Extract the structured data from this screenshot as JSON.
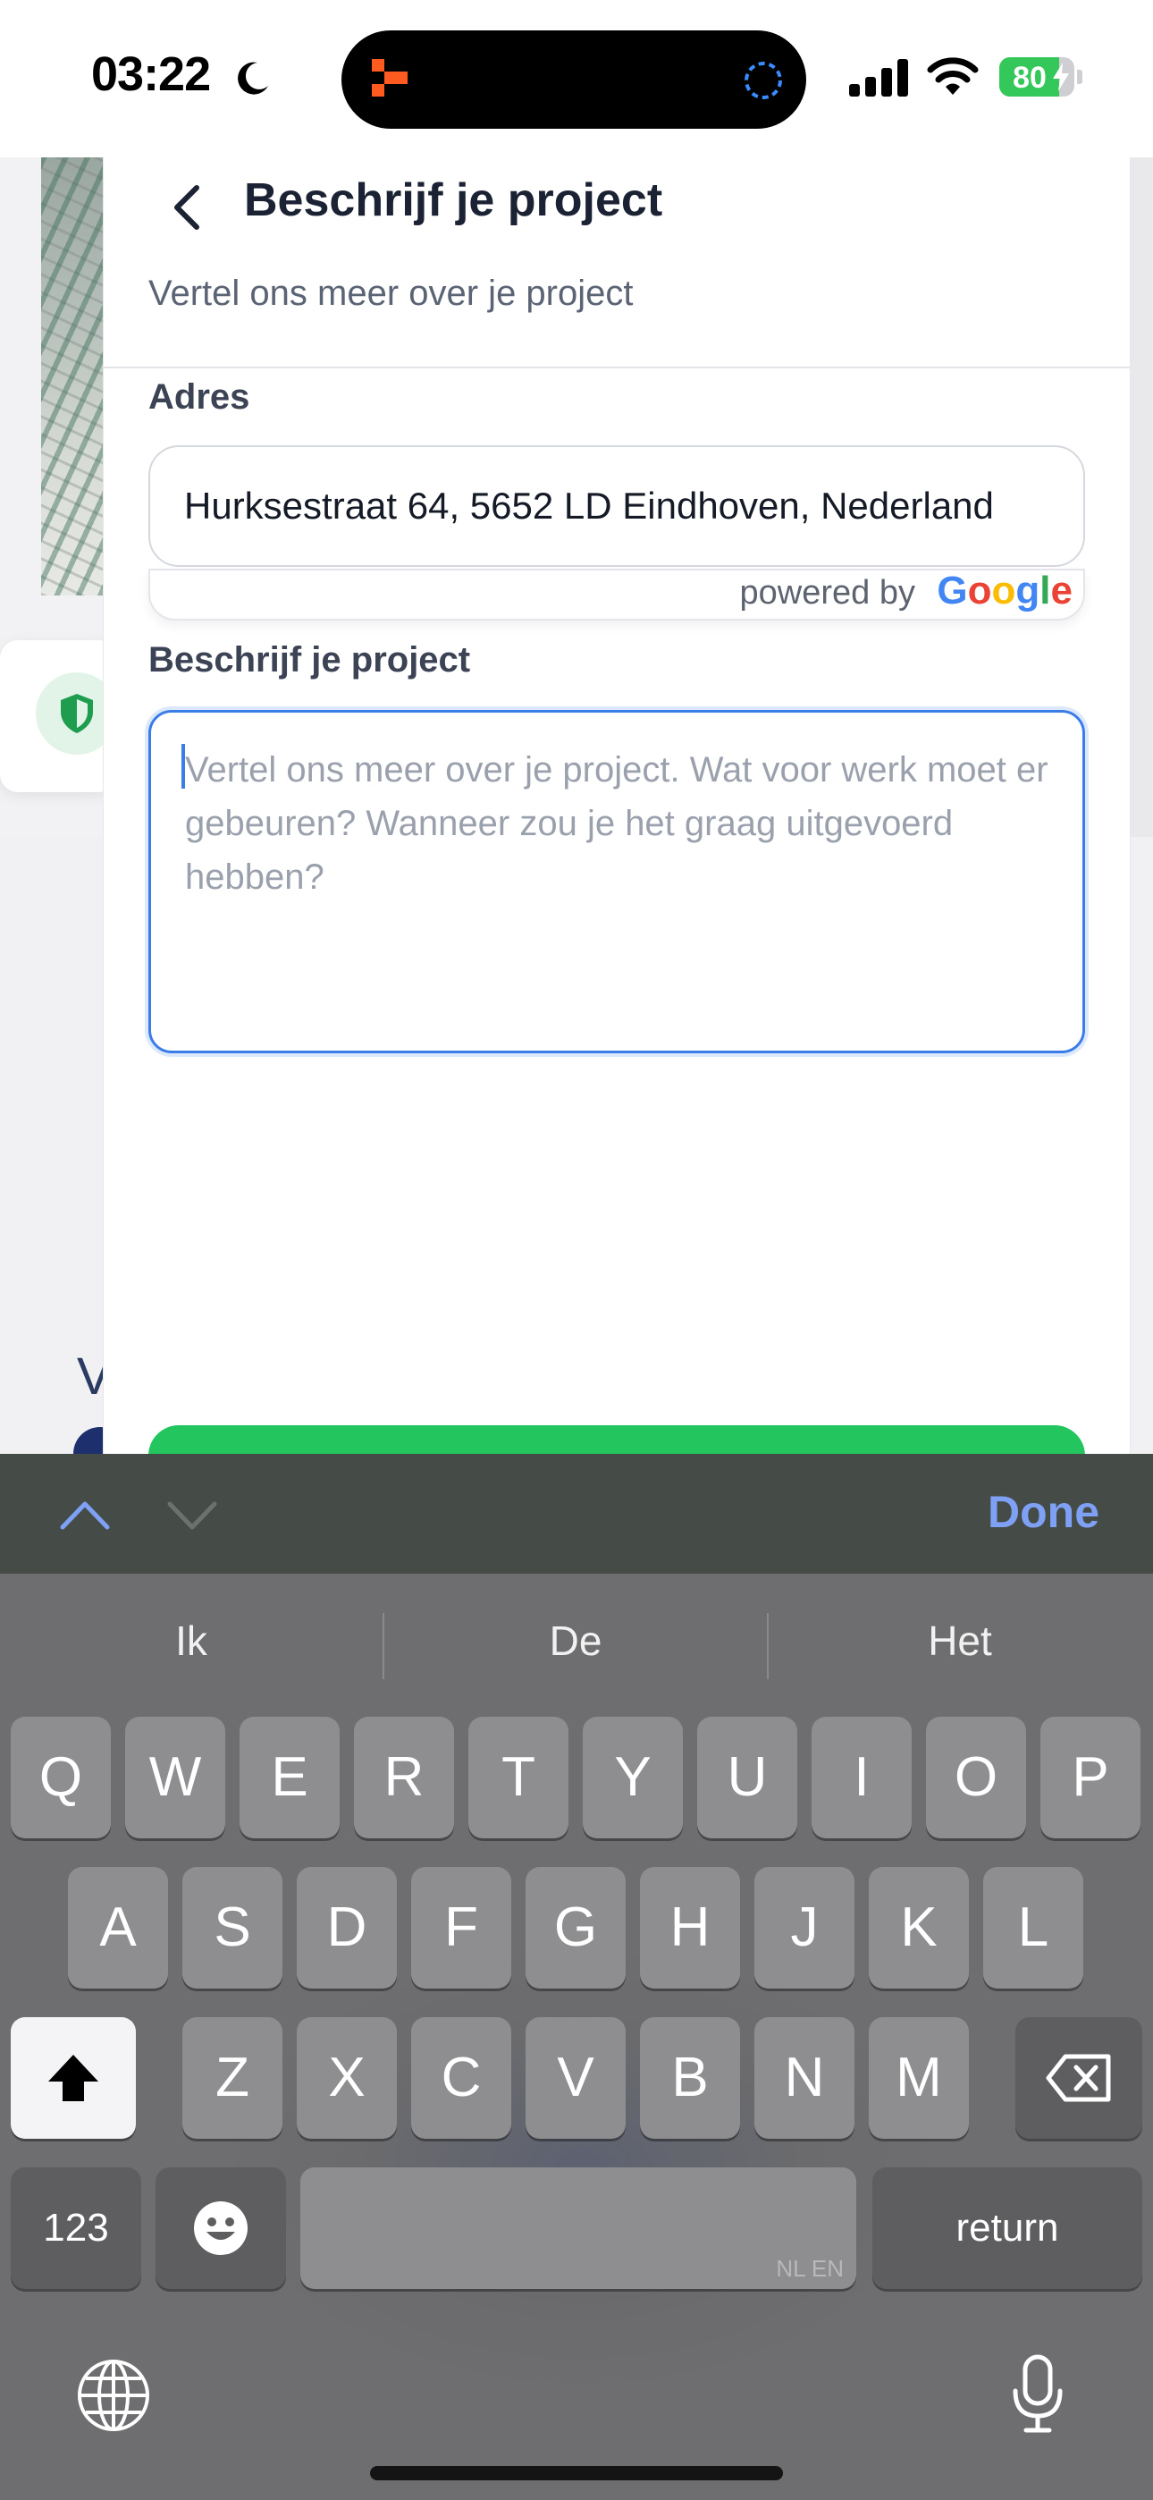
{
  "status_bar": {
    "time": "03:22",
    "battery_percent": 80,
    "battery_text": "80"
  },
  "sheet": {
    "title": "Beschrijf je project",
    "subtitle": "Vertel ons meer over je project",
    "address_label": "Adres",
    "address_value": "Hurksestraat 64, 5652 LD Eindhoven, Nederland",
    "powered_by": "powered by",
    "google": {
      "g1": "G",
      "o1": "o",
      "o2": "o",
      "g2": "g",
      "l": "l",
      "e": "e"
    },
    "project_label": "Beschrijf je project",
    "project_placeholder": "Vertel ons meer over je project. Wat voor werk moet er gebeuren? Wanneer zou je het graag uitgevoerd hebben?",
    "project_value": ""
  },
  "background": {
    "partial_letter": "V"
  },
  "keyboard": {
    "done_label": "Done",
    "suggestions": [
      "Ik",
      "De",
      "Het"
    ],
    "row1": [
      "Q",
      "W",
      "E",
      "R",
      "T",
      "Y",
      "U",
      "I",
      "O",
      "P"
    ],
    "row2": [
      "A",
      "S",
      "D",
      "F",
      "G",
      "H",
      "J",
      "K",
      "L"
    ],
    "row3": [
      "Z",
      "X",
      "C",
      "V",
      "B",
      "N",
      "M"
    ],
    "numbers_label": "123",
    "return_label": "return",
    "space_language": "NL EN"
  },
  "colors": {
    "accent_blue": "#3b7de8",
    "submit_green": "#22c55e",
    "battery_green": "#34c759",
    "done_blue": "#7fa1f5"
  }
}
